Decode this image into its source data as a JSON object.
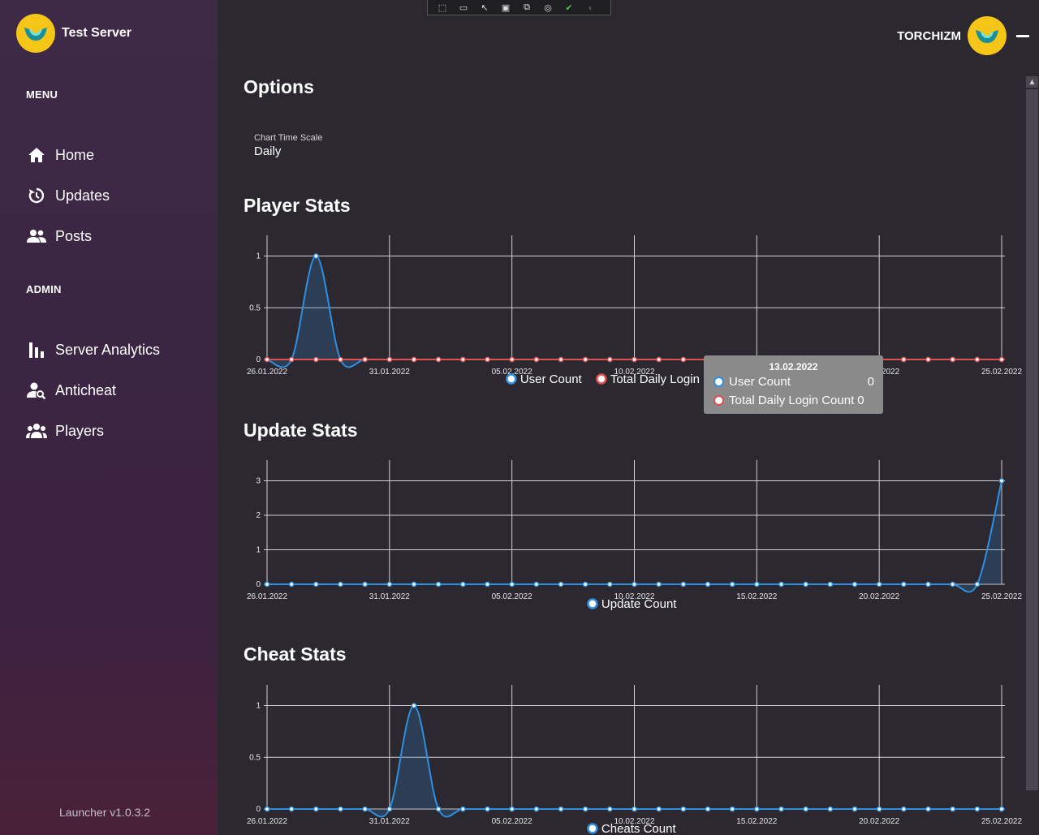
{
  "app": {
    "name": "Test Server",
    "version": "Launcher v1.0.3.2"
  },
  "user": {
    "name": "TORCHIZM"
  },
  "colors": {
    "accent_blue": "#2f8fe0",
    "accent_red": "#e05050",
    "logo_yellow": "#f5c518"
  },
  "sidebar": {
    "menu_label": "MENU",
    "admin_label": "ADMIN",
    "items": [
      {
        "label": "Home",
        "icon": "home-icon"
      },
      {
        "label": "Updates",
        "icon": "history-icon"
      },
      {
        "label": "Posts",
        "icon": "users-icon"
      }
    ],
    "admin_items": [
      {
        "label": "Server Analytics",
        "icon": "bar-chart-icon"
      },
      {
        "label": "Anticheat",
        "icon": "user-search-icon"
      },
      {
        "label": "Players",
        "icon": "group-icon"
      }
    ]
  },
  "options": {
    "title": "Options",
    "chart_time_scale_label": "Chart Time Scale",
    "chart_time_scale_value": "Daily"
  },
  "sections": {
    "player_stats": "Player Stats",
    "update_stats": "Update Stats",
    "cheat_stats": "Cheat Stats"
  },
  "tooltip": {
    "date": "13.02.2022",
    "rows": [
      {
        "label": "User Count",
        "value": "0"
      },
      {
        "label": "Total Daily Login Count",
        "value": "0"
      }
    ]
  },
  "chart_data": [
    {
      "type": "area",
      "title": "Player Stats",
      "x": [
        "26.01.2022",
        "27.01.2022",
        "28.01.2022",
        "29.01.2022",
        "30.01.2022",
        "31.01.2022",
        "01.02.2022",
        "02.02.2022",
        "03.02.2022",
        "04.02.2022",
        "05.02.2022",
        "06.02.2022",
        "07.02.2022",
        "08.02.2022",
        "09.02.2022",
        "10.02.2022",
        "11.02.2022",
        "12.02.2022",
        "13.02.2022",
        "14.02.2022",
        "15.02.2022",
        "16.02.2022",
        "17.02.2022",
        "18.02.2022",
        "19.02.2022",
        "20.02.2022",
        "21.02.2022",
        "22.02.2022",
        "23.02.2022",
        "24.02.2022",
        "25.02.2022"
      ],
      "x_ticks": [
        "26.01.2022",
        "31.01.2022",
        "05.02.2022",
        "10.02.2022",
        "15.02.2022",
        "20.02.2022",
        "25.02.2022"
      ],
      "y_ticks": [
        "0",
        "0.5",
        "1"
      ],
      "ylim": [
        0,
        1.2
      ],
      "series": [
        {
          "name": "User Count",
          "color": "#2f8fe0",
          "values": [
            0,
            0,
            1,
            0,
            0,
            0,
            0,
            0,
            0,
            0,
            0,
            0,
            0,
            0,
            0,
            0,
            0,
            0,
            0,
            0,
            0,
            0,
            0,
            0,
            0,
            0,
            0,
            0,
            0,
            0,
            0
          ]
        },
        {
          "name": "Total Daily Login Count",
          "color": "#e05050",
          "values": [
            0,
            0,
            0,
            0,
            0,
            0,
            0,
            0,
            0,
            0,
            0,
            0,
            0,
            0,
            0,
            0,
            0,
            0,
            0,
            0,
            0,
            0,
            0,
            0,
            0,
            0,
            0,
            0,
            0,
            0,
            0
          ]
        }
      ]
    },
    {
      "type": "area",
      "title": "Update Stats",
      "x_ticks": [
        "26.01.2022",
        "31.01.2022",
        "05.02.2022",
        "10.02.2022",
        "15.02.2022",
        "20.02.2022",
        "25.02.2022"
      ],
      "y_ticks": [
        "0",
        "1",
        "2",
        "3"
      ],
      "ylim": [
        0,
        3.6
      ],
      "series": [
        {
          "name": "Update Count",
          "color": "#2f8fe0",
          "values": [
            0,
            0,
            0,
            0,
            0,
            0,
            0,
            0,
            0,
            0,
            0,
            0,
            0,
            0,
            0,
            0,
            0,
            0,
            0,
            0,
            0,
            0,
            0,
            0,
            0,
            0,
            0,
            0,
            0,
            0,
            3
          ]
        }
      ]
    },
    {
      "type": "area",
      "title": "Cheat Stats",
      "x_ticks": [
        "26.01.2022",
        "31.01.2022",
        "05.02.2022",
        "10.02.2022",
        "15.02.2022",
        "20.02.2022",
        "25.02.2022"
      ],
      "y_ticks": [
        "0",
        "0.5",
        "1"
      ],
      "ylim": [
        0,
        1.2
      ],
      "series": [
        {
          "name": "Cheats Count",
          "color": "#2f8fe0",
          "values": [
            0,
            0,
            0,
            0,
            0,
            0,
            1,
            0,
            0,
            0,
            0,
            0,
            0,
            0,
            0,
            0,
            0,
            0,
            0,
            0,
            0,
            0,
            0,
            0,
            0,
            0,
            0,
            0,
            0,
            0,
            0
          ]
        }
      ]
    }
  ]
}
